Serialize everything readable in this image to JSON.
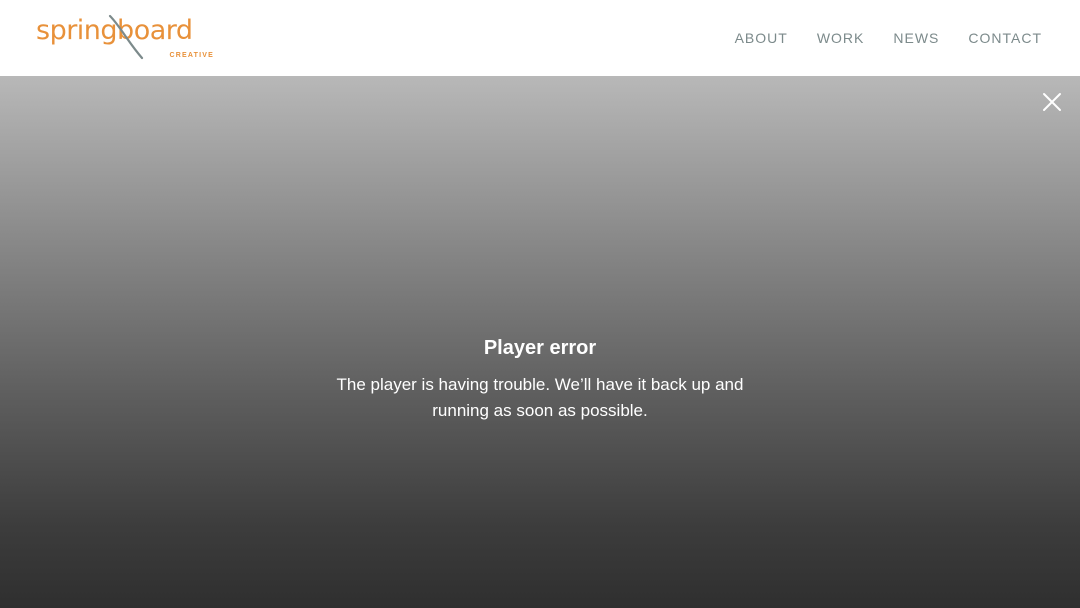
{
  "header": {
    "logo": {
      "word": "springboard",
      "subtitle": "CREATIVE",
      "brand_color": "#e8913a",
      "slash_color": "#7c8a8b"
    },
    "nav": [
      {
        "label": "ABOUT"
      },
      {
        "label": "WORK"
      },
      {
        "label": "NEWS"
      },
      {
        "label": "CONTACT"
      }
    ],
    "nav_color": "#7c8a8b"
  },
  "player": {
    "close_icon": "close-icon",
    "error_title": "Player error",
    "error_message": "The player is having trouble. We’ll have it back up and running as soon as possible."
  }
}
